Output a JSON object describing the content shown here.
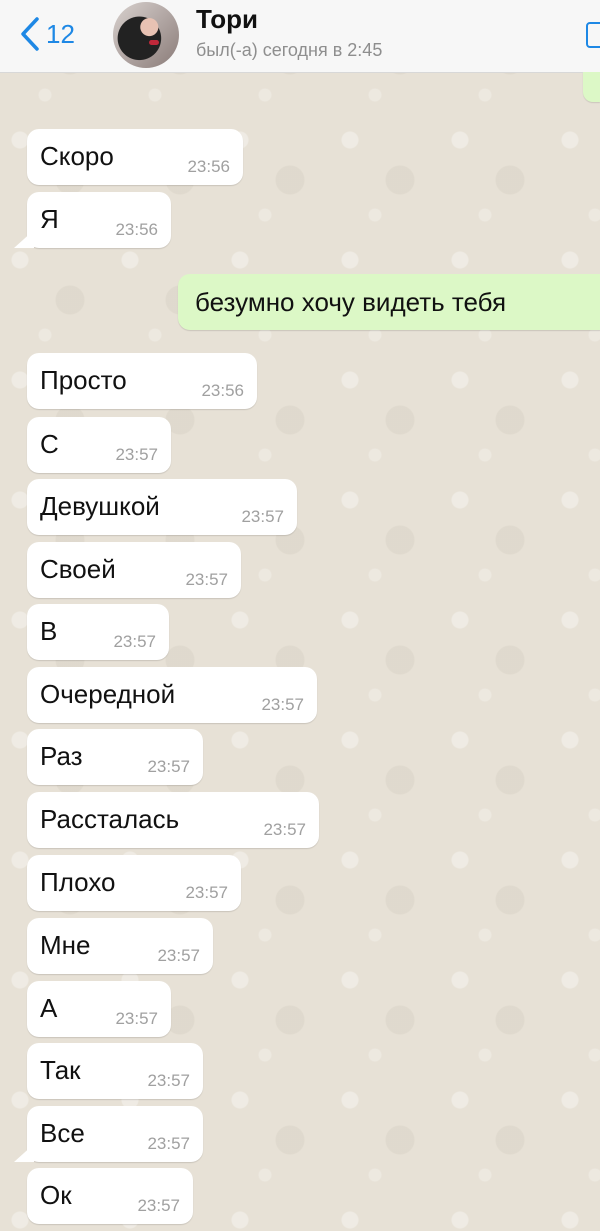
{
  "header": {
    "back_count": "12",
    "contact_name": "Тори",
    "contact_status": "был(-а) сегодня в 2:45"
  },
  "messages": [
    {
      "text": "Скоро",
      "time": "23:56",
      "dir": "in"
    },
    {
      "text": "Я",
      "time": "23:56",
      "dir": "in"
    },
    {
      "text": "безумно хочу видеть тебя",
      "time": "",
      "dir": "out"
    },
    {
      "text": "Просто",
      "time": "23:56",
      "dir": "in"
    },
    {
      "text": "С",
      "time": "23:57",
      "dir": "in"
    },
    {
      "text": "Девушкой",
      "time": "23:57",
      "dir": "in"
    },
    {
      "text": "Своей",
      "time": "23:57",
      "dir": "in"
    },
    {
      "text": "В",
      "time": "23:57",
      "dir": "in"
    },
    {
      "text": "Очередной",
      "time": "23:57",
      "dir": "in"
    },
    {
      "text": "Раз",
      "time": "23:57",
      "dir": "in"
    },
    {
      "text": "Рассталась",
      "time": "23:57",
      "dir": "in"
    },
    {
      "text": "Плохо",
      "time": "23:57",
      "dir": "in"
    },
    {
      "text": "Мне",
      "time": "23:57",
      "dir": "in"
    },
    {
      "text": "А",
      "time": "23:57",
      "dir": "in"
    },
    {
      "text": "Так",
      "time": "23:57",
      "dir": "in"
    },
    {
      "text": "Все",
      "time": "23:57",
      "dir": "in"
    },
    {
      "text": "Ок",
      "time": "23:57",
      "dir": "in"
    }
  ]
}
